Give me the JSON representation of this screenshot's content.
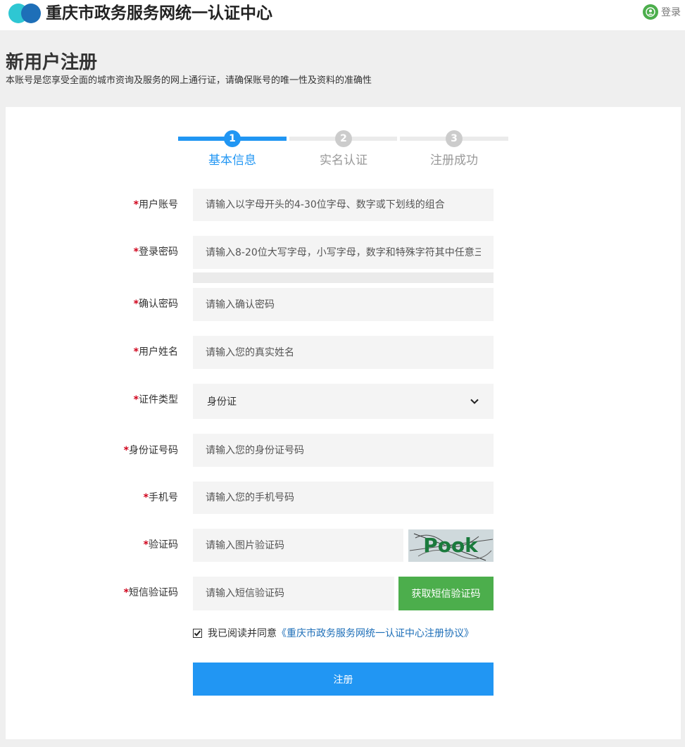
{
  "header": {
    "site_title": "重庆市政务服务网统一认证中心",
    "login_label": "登录"
  },
  "page": {
    "title": "新用户注册",
    "subtitle": "本账号是您享受全面的城市资询及服务的网上通行证，请确保账号的唯一性及资料的准确性"
  },
  "steps": [
    {
      "number": "1",
      "label": "基本信息",
      "active": true
    },
    {
      "number": "2",
      "label": "实名认证",
      "active": false
    },
    {
      "number": "3",
      "label": "注册成功",
      "active": false
    }
  ],
  "form": {
    "required_mark": "*",
    "username": {
      "label": "用户账号",
      "placeholder": "请输入以字母开头的4-30位字母、数字或下划线的组合"
    },
    "password": {
      "label": "登录密码",
      "placeholder": "请输入8-20位大写字母，小写字母，数字和特殊字符其中任意三"
    },
    "confirm_password": {
      "label": "确认密码",
      "placeholder": "请输入确认密码"
    },
    "real_name": {
      "label": "用户姓名",
      "placeholder": "请输入您的真实姓名"
    },
    "id_type": {
      "label": "证件类型",
      "value": "身份证"
    },
    "id_number": {
      "label": "身份证号码",
      "placeholder": "请输入您的身份证号码"
    },
    "phone": {
      "label": "手机号",
      "placeholder": "请输入您的手机号码"
    },
    "captcha": {
      "label": "验证码",
      "placeholder": "请输入图片验证码",
      "image_text": "Pook"
    },
    "sms_code": {
      "label": "短信验证码",
      "placeholder": "请输入短信验证码",
      "button_label": "获取短信验证码"
    },
    "agreement": {
      "prefix": "我已阅读并同意",
      "link_text": "《重庆市政务服务网统一认证中心注册协议》",
      "checked": true
    },
    "submit_label": "注册"
  },
  "colors": {
    "accent_blue": "#2196f3",
    "success_green": "#4cae4c",
    "required_red": "#d0021b",
    "inactive_gray": "#cccccc",
    "link_blue": "#1e6fb8"
  }
}
